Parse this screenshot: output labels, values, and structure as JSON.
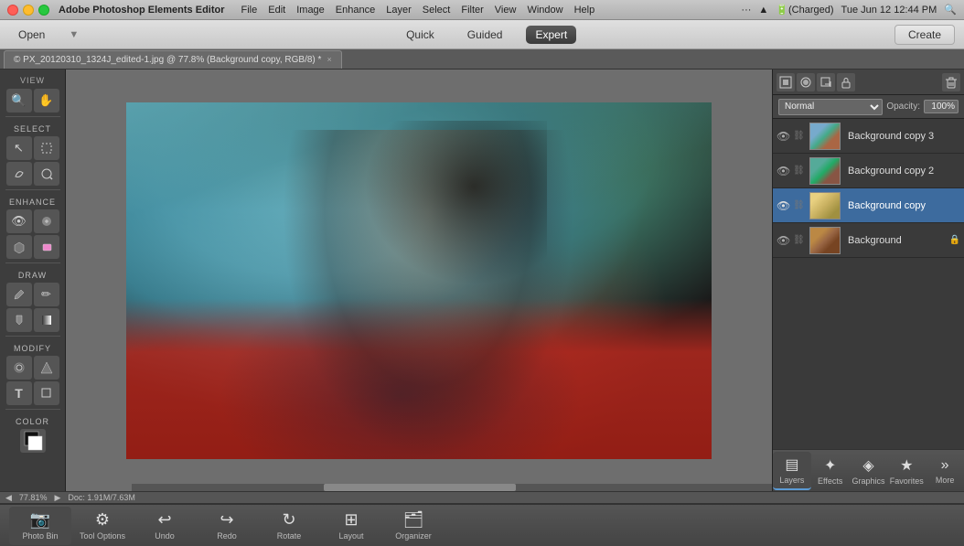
{
  "app": {
    "title": "Adobe Photoshop Elements Editor",
    "version": ""
  },
  "menubar": {
    "menus": [
      "File",
      "Edit",
      "Image",
      "Enhance",
      "Layer",
      "Select",
      "Filter",
      "View",
      "Window",
      "Help"
    ],
    "status_icons": [
      "···",
      "WiFi",
      "Battery",
      "Charged"
    ],
    "datetime": "Tue Jun 12  12:44 PM"
  },
  "toolbar": {
    "open_label": "Open",
    "quick_label": "Quick",
    "guided_label": "Guided",
    "expert_label": "Expert",
    "create_label": "Create"
  },
  "tab": {
    "title": "© PX_20120310_1324J_edited-1.jpg @ 77.8% (Background copy, RGB/8) *",
    "close": "×"
  },
  "tools": {
    "view_label": "VIEW",
    "select_label": "SELECT",
    "enhance_label": "ENHANCE",
    "draw_label": "DRAW",
    "modify_label": "MODIFY",
    "color_label": "COLOR",
    "buttons": [
      {
        "icon": "🔍",
        "name": "zoom-tool"
      },
      {
        "icon": "✋",
        "name": "hand-tool"
      },
      {
        "icon": "↖",
        "name": "move-tool"
      },
      {
        "icon": "⬚",
        "name": "marquee-tool"
      },
      {
        "icon": "🔦",
        "name": "spot-healing-tool"
      },
      {
        "icon": "🖌",
        "name": "brush-tool"
      },
      {
        "icon": "✏",
        "name": "pencil-tool"
      },
      {
        "icon": "🪣",
        "name": "paint-bucket-tool"
      },
      {
        "icon": "T",
        "name": "type-tool"
      },
      {
        "icon": "◻",
        "name": "shape-tool"
      }
    ]
  },
  "canvas": {
    "zoom": "77.81%",
    "doc_size": "Doc: 1.91M/7.63M"
  },
  "layers_panel": {
    "blend_mode": "Normal",
    "opacity_label": "Opacity:",
    "opacity_value": "100%",
    "layers": [
      {
        "name": "Background copy 3",
        "id": "bg-copy-3",
        "visible": true,
        "active": false
      },
      {
        "name": "Background copy 2",
        "id": "bg-copy-2",
        "visible": true,
        "active": false
      },
      {
        "name": "Background copy",
        "id": "bg-copy",
        "visible": true,
        "active": true
      },
      {
        "name": "Background",
        "id": "bg",
        "visible": true,
        "active": false,
        "locked": true
      }
    ]
  },
  "bottom_toolbar": {
    "buttons": [
      {
        "label": "Photo Bin",
        "icon": "📷",
        "name": "photo-bin-btn"
      },
      {
        "label": "Tool Options",
        "icon": "⚙",
        "name": "tool-options-btn"
      },
      {
        "label": "Undo",
        "icon": "↩",
        "name": "undo-btn"
      },
      {
        "label": "Redo",
        "icon": "↪",
        "name": "redo-btn"
      },
      {
        "label": "Rotate",
        "icon": "↻",
        "name": "rotate-btn"
      },
      {
        "label": "Layout",
        "icon": "⊞",
        "name": "layout-btn"
      },
      {
        "label": "Organizer",
        "icon": "🗂",
        "name": "organizer-btn"
      }
    ]
  },
  "panel_tabs": {
    "buttons": [
      {
        "label": "Layers",
        "icon": "▤",
        "name": "layers-tab",
        "active": true
      },
      {
        "label": "Effects",
        "icon": "✨",
        "name": "effects-tab",
        "active": false
      },
      {
        "label": "Graphics",
        "icon": "◈",
        "name": "graphics-tab",
        "active": false
      },
      {
        "label": "Favorites",
        "icon": "★",
        "name": "favorites-tab",
        "active": false
      },
      {
        "label": "More",
        "icon": "»",
        "name": "more-tab",
        "active": false
      }
    ]
  }
}
